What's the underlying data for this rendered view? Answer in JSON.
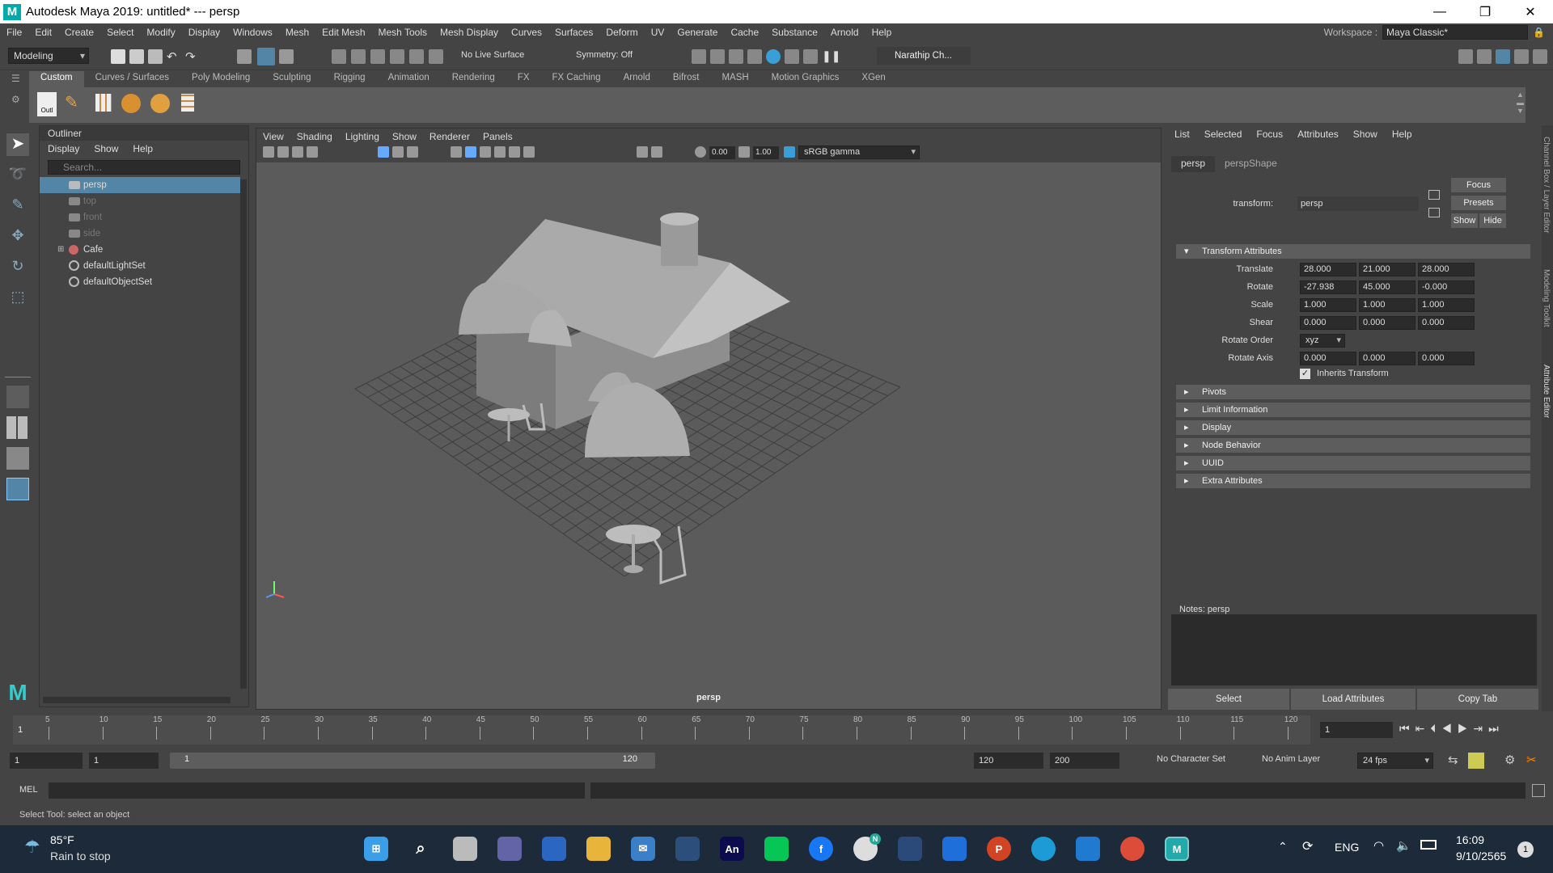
{
  "app": {
    "logo": "M",
    "title": "Autodesk Maya 2019: untitled*   ---   persp",
    "win_minimize": "—",
    "win_restore": "❐",
    "win_close": "✕"
  },
  "menus": [
    "File",
    "Edit",
    "Create",
    "Select",
    "Modify",
    "Display",
    "Windows",
    "Mesh",
    "Edit Mesh",
    "Mesh Tools",
    "Mesh Display",
    "Curves",
    "Surfaces",
    "Deform",
    "UV",
    "Generate",
    "Cache",
    "Substance",
    "Arnold",
    "Help"
  ],
  "workspace": {
    "label": "Workspace :",
    "value": "Maya Classic*"
  },
  "statusline": {
    "menuset": "Modeling",
    "live_surface": "No Live Surface",
    "symmetry": "Symmetry: Off",
    "user": "Narathip Ch..."
  },
  "shelf": {
    "tabs": [
      "Custom",
      "Curves / Surfaces",
      "Poly Modeling",
      "Sculpting",
      "Rigging",
      "Animation",
      "Rendering",
      "FX",
      "FX Caching",
      "Arnold",
      "Bifrost",
      "MASH",
      "Motion Graphics",
      "XGen"
    ],
    "active_tab": "Custom",
    "first_icon_label": "Outl"
  },
  "outliner": {
    "title": "Outliner",
    "menu": [
      "Display",
      "Show",
      "Help"
    ],
    "search_placeholder": "Search...",
    "items": [
      {
        "label": "persp",
        "selected": true,
        "dim": false
      },
      {
        "label": "top",
        "selected": false,
        "dim": true
      },
      {
        "label": "front",
        "selected": false,
        "dim": true
      },
      {
        "label": "side",
        "selected": false,
        "dim": true
      },
      {
        "label": "Cafe",
        "selected": false,
        "dim": false
      },
      {
        "label": "defaultLightSet",
        "selected": false,
        "dim": false
      },
      {
        "label": "defaultObjectSet",
        "selected": false,
        "dim": false
      }
    ]
  },
  "viewport": {
    "menu": [
      "View",
      "Shading",
      "Lighting",
      "Show",
      "Renderer",
      "Panels"
    ],
    "exposure": "0.00",
    "gamma": "1.00",
    "colorspace": "sRGB gamma",
    "camera_label": "persp"
  },
  "attribute_editor": {
    "menu": [
      "List",
      "Selected",
      "Focus",
      "Attributes",
      "Show",
      "Help"
    ],
    "tabs": [
      "persp",
      "perspShape"
    ],
    "transform_label": "transform:",
    "transform_value": "persp",
    "focus_btn": "Focus",
    "presets_btn": "Presets",
    "show_btn": "Show",
    "hide_btn": "Hide",
    "section_transform": "Transform Attributes",
    "translate_label": "Translate",
    "translate": [
      "28.000",
      "21.000",
      "28.000"
    ],
    "rotate_label": "Rotate",
    "rotate": [
      "-27.938",
      "45.000",
      "-0.000"
    ],
    "scale_label": "Scale",
    "scale": [
      "1.000",
      "1.000",
      "1.000"
    ],
    "shear_label": "Shear",
    "shear": [
      "0.000",
      "0.000",
      "0.000"
    ],
    "rotate_order_label": "Rotate Order",
    "rotate_order": "xyz",
    "rotate_axis_label": "Rotate Axis",
    "rotate_axis": [
      "0.000",
      "0.000",
      "0.000"
    ],
    "inherits_transform": "Inherits Transform",
    "sections": [
      "Pivots",
      "Limit Information",
      "Display",
      "Node Behavior",
      "UUID",
      "Extra Attributes"
    ],
    "notes_label": "Notes:  persp",
    "buttons": [
      "Select",
      "Load Attributes",
      "Copy Tab"
    ]
  },
  "right_tabs": [
    "Channel Box / Layer Editor",
    "Modeling Toolkit",
    "Attribute Editor"
  ],
  "timeslider": {
    "ticks": [
      "5",
      "10",
      "15",
      "20",
      "25",
      "30",
      "35",
      "40",
      "45",
      "50",
      "55",
      "60",
      "65",
      "70",
      "75",
      "80",
      "85",
      "90",
      "95",
      "100",
      "105",
      "110",
      "115",
      "120"
    ],
    "start_frame": "1",
    "current_frame": "1"
  },
  "range": {
    "start": "1",
    "start_inner": "1",
    "slider_start": "1",
    "slider_end": "120",
    "end_inner": "120",
    "end": "200",
    "character_set": "No Character Set",
    "anim_layer": "No Anim Layer",
    "fps": "24 fps"
  },
  "mel": {
    "label": "MEL"
  },
  "helpline": "Select Tool: select an object",
  "taskbar": {
    "weather_temp": "85°F",
    "weather_desc": "Rain to stop",
    "lang": "ENG",
    "time": "16:09",
    "date": "9/10/2565",
    "notif_count": "1",
    "chrome_badge": "N",
    "an_label": "An"
  }
}
